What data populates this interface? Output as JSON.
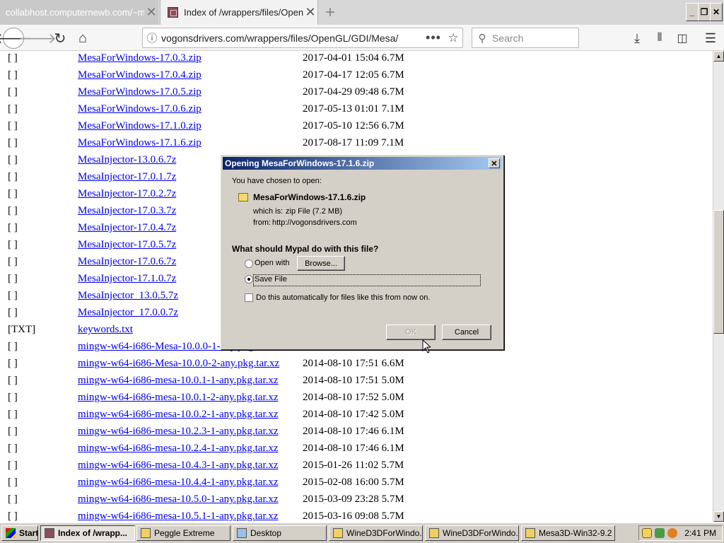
{
  "browser": {
    "tabs": [
      {
        "title": "collabhost.computernewb.com/~mv/",
        "active": false
      },
      {
        "title": "Index of /wrappers/files/OpenGL/",
        "active": true
      }
    ],
    "new_tab": "+",
    "window_controls": {
      "minimize": "_",
      "restore": "❐",
      "close": "✕"
    },
    "url": "vogonsdrivers.com/wrappers/files/OpenGL/GDI/Mesa/",
    "search_placeholder": "Search",
    "icons": [
      "back-arrow-icon",
      "forward-arrow-icon",
      "reload-icon",
      "home-icon",
      "info-icon",
      "more-icon",
      "bookmark-star-icon",
      "search-icon",
      "download-icon",
      "library-icon",
      "sidebar-icon",
      "menu-icon"
    ]
  },
  "listing": [
    {
      "icon": "[ ]",
      "name": "MesaForWindows-17.0.3.zip",
      "date": "2017-04-01 15:04",
      "size": "6.7M"
    },
    {
      "icon": "[ ]",
      "name": "MesaForWindows-17.0.4.zip",
      "date": "2017-04-17 12:05",
      "size": "6.7M"
    },
    {
      "icon": "[ ]",
      "name": "MesaForWindows-17.0.5.zip",
      "date": "2017-04-29 09:48",
      "size": "6.7M"
    },
    {
      "icon": "[ ]",
      "name": "MesaForWindows-17.0.6.zip",
      "date": "2017-05-13 01:01",
      "size": "7.1M"
    },
    {
      "icon": "[ ]",
      "name": "MesaForWindows-17.1.0.zip",
      "date": "2017-05-10 12:56",
      "size": "6.7M"
    },
    {
      "icon": "[ ]",
      "name": "MesaForWindows-17.1.6.zip",
      "date": "2017-08-17 11:09",
      "size": "7.1M"
    },
    {
      "icon": "[ ]",
      "name": "MesaInjector-13.0.6.7z",
      "date": "",
      "size": ""
    },
    {
      "icon": "[ ]",
      "name": "MesaInjector-17.0.1.7z",
      "date": "",
      "size": ""
    },
    {
      "icon": "[ ]",
      "name": "MesaInjector-17.0.2.7z",
      "date": "",
      "size": ""
    },
    {
      "icon": "[ ]",
      "name": "MesaInjector-17.0.3.7z",
      "date": "",
      "size": ""
    },
    {
      "icon": "[ ]",
      "name": "MesaInjector-17.0.4.7z",
      "date": "",
      "size": ""
    },
    {
      "icon": "[ ]",
      "name": "MesaInjector-17.0.5.7z",
      "date": "",
      "size": ""
    },
    {
      "icon": "[ ]",
      "name": "MesaInjector-17.0.6.7z",
      "date": "",
      "size": ""
    },
    {
      "icon": "[ ]",
      "name": "MesaInjector-17.1.0.7z",
      "date": "",
      "size": ""
    },
    {
      "icon": "[ ]",
      "name": "MesaInjector_13.0.5.7z",
      "date": "",
      "size": ""
    },
    {
      "icon": "[ ]",
      "name": "MesaInjector_17.0.0.7z",
      "date": "",
      "size": ""
    },
    {
      "icon": "[TXT]",
      "name": "keywords.txt",
      "date": "",
      "size": ""
    },
    {
      "icon": "[ ]",
      "name": "mingw-w64-i686-Mesa-10.0.0-1-any.pkg.tar.xz",
      "date": "",
      "size": ""
    },
    {
      "icon": "[ ]",
      "name": "mingw-w64-i686-Mesa-10.0.0-2-any.pkg.tar.xz",
      "date": "2014-08-10 17:51",
      "size": "6.6M"
    },
    {
      "icon": "[ ]",
      "name": "mingw-w64-i686-mesa-10.0.1-1-any.pkg.tar.xz",
      "date": "2014-08-10 17:51",
      "size": "5.0M"
    },
    {
      "icon": "[ ]",
      "name": "mingw-w64-i686-mesa-10.0.1-2-any.pkg.tar.xz",
      "date": "2014-08-10 17:52",
      "size": "5.0M"
    },
    {
      "icon": "[ ]",
      "name": "mingw-w64-i686-mesa-10.0.2-1-any.pkg.tar.xz",
      "date": "2014-08-10 17:42",
      "size": "5.0M"
    },
    {
      "icon": "[ ]",
      "name": "mingw-w64-i686-mesa-10.2.3-1-any.pkg.tar.xz",
      "date": "2014-08-10 17:46",
      "size": "6.1M"
    },
    {
      "icon": "[ ]",
      "name": "mingw-w64-i686-mesa-10.2.4-1-any.pkg.tar.xz",
      "date": "2014-08-10 17:46",
      "size": "6.1M"
    },
    {
      "icon": "[ ]",
      "name": "mingw-w64-i686-mesa-10.4.3-1-any.pkg.tar.xz",
      "date": "2015-01-26 11:02",
      "size": "5.7M"
    },
    {
      "icon": "[ ]",
      "name": "mingw-w64-i686-mesa-10.4.4-1-any.pkg.tar.xz",
      "date": "2015-02-08 16:00",
      "size": "5.7M"
    },
    {
      "icon": "[ ]",
      "name": "mingw-w64-i686-mesa-10.5.0-1-any.pkg.tar.xz",
      "date": "2015-03-09 23:28",
      "size": "5.7M"
    },
    {
      "icon": "[ ]",
      "name": "mingw-w64-i686-mesa-10.5.1-1-any.pkg.tar.xz",
      "date": "2015-03-16 09:08",
      "size": "5.7M"
    }
  ],
  "dialog": {
    "title": "Opening MesaForWindows-17.1.6.zip",
    "close": "✕",
    "intro": "You have chosen to open:",
    "filename": "MesaForWindows-17.1.6.zip",
    "which_is_label": "which is:",
    "which_is_value": "zip File (7.2 MB)",
    "from_label": "from:",
    "from_value": "http://vogonsdrivers.com",
    "question": "What should Mypal do with this file?",
    "open_with_label": "Open with",
    "browse_label": "Browse...",
    "save_file_label": "Save File",
    "selected_action": "save",
    "auto_label": "Do this automatically for files like this from now on.",
    "auto_checked": false,
    "ok_label": "OK",
    "cancel_label": "Cancel"
  },
  "taskbar": {
    "start": "Start",
    "items": [
      {
        "label": "Index of /wrapp...",
        "active": true
      },
      {
        "label": "Peggle Extreme",
        "active": false
      },
      {
        "label": "Desktop",
        "active": false
      },
      {
        "label": "WineD3DForWindo...",
        "active": false
      },
      {
        "label": "WineD3DForWindo...",
        "active": false
      },
      {
        "label": "Mesa3D-Win32-9.2 ...",
        "active": false
      }
    ],
    "clock": "2:41 PM"
  }
}
